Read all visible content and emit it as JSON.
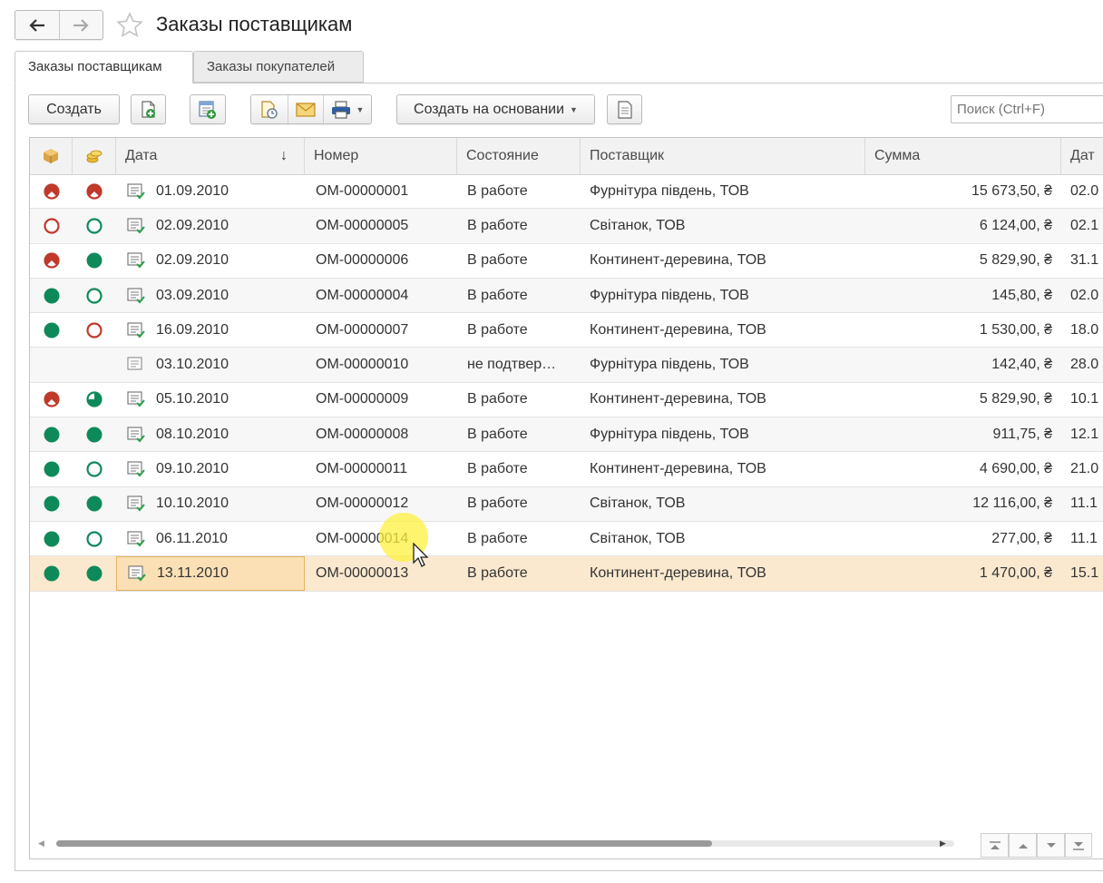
{
  "window": {
    "title": "Заказы поставщикам"
  },
  "tabs": [
    {
      "label": "Заказы поставщикам",
      "active": true
    },
    {
      "label": "Заказы покупателей",
      "active": false
    }
  ],
  "toolbar": {
    "create_label": "Создать",
    "create_based_label": "Создать на основании",
    "search_placeholder": "Поиск (Ctrl+F)"
  },
  "table": {
    "columns": [
      "Дата",
      "Номер",
      "Состояние",
      "Поставщик",
      "Сумма",
      "Дат"
    ],
    "sort_column": "Дата",
    "sort_direction": "desc",
    "rows": [
      {
        "s1": "half",
        "s2": "half",
        "date": "01.09.2010",
        "number": "ОМ-00000001",
        "state": "В работе",
        "supplier": "Фурнітура південь, ТОВ",
        "sum": "15 673,50, ₴",
        "date2": "02.0"
      },
      {
        "s1": "empty",
        "s2": "empty-green",
        "date": "02.09.2010",
        "number": "ОМ-00000005",
        "state": "В работе",
        "supplier": "Світанок, ТОВ",
        "sum": "6 124,00, ₴",
        "date2": "02.1"
      },
      {
        "s1": "half",
        "s2": "full",
        "date": "02.09.2010",
        "number": "ОМ-00000006",
        "state": "В работе",
        "supplier": "Континент-деревина, ТОВ",
        "sum": "5 829,90, ₴",
        "date2": "31.1"
      },
      {
        "s1": "full",
        "s2": "empty-green",
        "date": "03.09.2010",
        "number": "ОМ-00000004",
        "state": "В работе",
        "supplier": "Фурнітура південь, ТОВ",
        "sum": "145,80, ₴",
        "date2": "02.0"
      },
      {
        "s1": "full",
        "s2": "empty",
        "date": "16.09.2010",
        "number": "ОМ-00000007",
        "state": "В работе",
        "supplier": "Континент-деревина, ТОВ",
        "sum": "1 530,00, ₴",
        "date2": "18.0"
      },
      {
        "s1": "none",
        "s2": "none",
        "date": "03.10.2010",
        "number": "ОМ-00000010",
        "state": "не подтвер…",
        "supplier": "Фурнітура південь, ТОВ",
        "sum": "142,40, ₴",
        "date2": "28.0"
      },
      {
        "s1": "half",
        "s2": "half-green",
        "date": "05.10.2010",
        "number": "ОМ-00000009",
        "state": "В работе",
        "supplier": "Континент-деревина, ТОВ",
        "sum": "5 829,90, ₴",
        "date2": "10.1"
      },
      {
        "s1": "full",
        "s2": "full",
        "date": "08.10.2010",
        "number": "ОМ-00000008",
        "state": "В работе",
        "supplier": "Фурнітура південь, ТОВ",
        "sum": "911,75, ₴",
        "date2": "12.1"
      },
      {
        "s1": "full",
        "s2": "empty-green",
        "date": "09.10.2010",
        "number": "ОМ-00000011",
        "state": "В работе",
        "supplier": "Континент-деревина, ТОВ",
        "sum": "4 690,00, ₴",
        "date2": "21.0"
      },
      {
        "s1": "full",
        "s2": "full",
        "date": "10.10.2010",
        "number": "ОМ-00000012",
        "state": "В работе",
        "supplier": "Світанок, ТОВ",
        "sum": "12 116,00, ₴",
        "date2": "11.1"
      },
      {
        "s1": "full",
        "s2": "empty-green",
        "date": "06.11.2010",
        "number": "ОМ-00000014",
        "state": "В работе",
        "supplier": "Світанок, ТОВ",
        "sum": "277,00, ₴",
        "date2": "11.1"
      },
      {
        "s1": "full",
        "s2": "full",
        "date": "13.11.2010",
        "number": "ОМ-00000013",
        "state": "В работе",
        "supplier": "Континент-деревина, ТОВ",
        "sum": "1 470,00, ₴",
        "date2": "15.1",
        "selected": true
      }
    ]
  },
  "scrollbar": {
    "position": 0.0,
    "visible_fraction": 0.73
  },
  "colors": {
    "green": "#0e8a5a",
    "red": "#c0392b",
    "selected_row": "#fbe9cf",
    "selected_cell_border": "#e4b35d"
  }
}
